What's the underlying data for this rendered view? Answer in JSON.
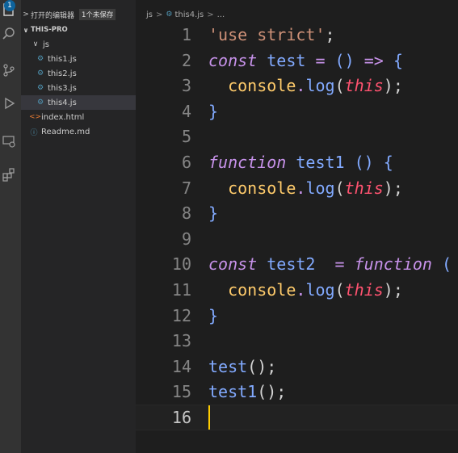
{
  "activity_bar": {
    "badge": "1",
    "icons": [
      "explorer-icon",
      "search-icon",
      "source-control-icon",
      "run-debug-icon",
      "remote-explorer-icon",
      "extensions-icon"
    ]
  },
  "sidebar": {
    "open_editors_label": "打开的编辑器",
    "unsaved_badge": "1个未保存",
    "project_name": "THIS-PRO",
    "folder": "js",
    "files": [
      "this1.js",
      "this2.js",
      "this3.js",
      "this4.js"
    ],
    "selected_file": "this4.js",
    "root_files": [
      "index.html",
      "Readme.md"
    ]
  },
  "breadcrumb": {
    "folder": "js",
    "file": "this4.js",
    "more": "..."
  },
  "editor": {
    "current_line": "16",
    "lines": [
      {
        "n": "1",
        "tokens": [
          {
            "t": "'use strict'",
            "c": "str"
          },
          {
            "t": ";",
            "c": "pl"
          }
        ]
      },
      {
        "n": "2",
        "tokens": [
          {
            "t": "const",
            "c": "kw"
          },
          {
            "t": " test ",
            "c": "fn"
          },
          {
            "t": "=",
            "c": "op"
          },
          {
            "t": " () ",
            "c": "fn"
          },
          {
            "t": "=>",
            "c": "op"
          },
          {
            "t": " {",
            "c": "fn"
          }
        ]
      },
      {
        "n": "3",
        "tokens": [
          {
            "t": "  ",
            "c": "pl"
          },
          {
            "t": "console",
            "c": "var"
          },
          {
            "t": ".",
            "c": "op"
          },
          {
            "t": "log",
            "c": "fn"
          },
          {
            "t": "(",
            "c": "pl"
          },
          {
            "t": "this",
            "c": "this"
          },
          {
            "t": ");",
            "c": "pl"
          }
        ]
      },
      {
        "n": "4",
        "tokens": [
          {
            "t": "}",
            "c": "fn"
          }
        ]
      },
      {
        "n": "5",
        "tokens": []
      },
      {
        "n": "6",
        "tokens": [
          {
            "t": "function",
            "c": "kw"
          },
          {
            "t": " test1 () {",
            "c": "fn"
          }
        ]
      },
      {
        "n": "7",
        "tokens": [
          {
            "t": "  ",
            "c": "pl"
          },
          {
            "t": "console",
            "c": "var"
          },
          {
            "t": ".",
            "c": "op"
          },
          {
            "t": "log",
            "c": "fn"
          },
          {
            "t": "(",
            "c": "pl"
          },
          {
            "t": "this",
            "c": "this"
          },
          {
            "t": ");",
            "c": "pl"
          }
        ]
      },
      {
        "n": "8",
        "tokens": [
          {
            "t": "}",
            "c": "fn"
          }
        ]
      },
      {
        "n": "9",
        "tokens": []
      },
      {
        "n": "10",
        "tokens": [
          {
            "t": "const",
            "c": "kw"
          },
          {
            "t": " test2  ",
            "c": "fn"
          },
          {
            "t": "=",
            "c": "op"
          },
          {
            "t": " ",
            "c": "pl"
          },
          {
            "t": "function",
            "c": "kw"
          },
          {
            "t": " (",
            "c": "fn"
          }
        ]
      },
      {
        "n": "11",
        "tokens": [
          {
            "t": "  ",
            "c": "pl"
          },
          {
            "t": "console",
            "c": "var"
          },
          {
            "t": ".",
            "c": "op"
          },
          {
            "t": "log",
            "c": "fn"
          },
          {
            "t": "(",
            "c": "pl"
          },
          {
            "t": "this",
            "c": "this"
          },
          {
            "t": ");",
            "c": "pl"
          }
        ]
      },
      {
        "n": "12",
        "tokens": [
          {
            "t": "}",
            "c": "fn"
          }
        ]
      },
      {
        "n": "13",
        "tokens": []
      },
      {
        "n": "14",
        "tokens": [
          {
            "t": "test",
            "c": "fn"
          },
          {
            "t": "();",
            "c": "pl"
          }
        ]
      },
      {
        "n": "15",
        "tokens": [
          {
            "t": "test1",
            "c": "fn"
          },
          {
            "t": "();",
            "c": "pl"
          }
        ]
      },
      {
        "n": "16",
        "tokens": []
      }
    ]
  },
  "colors": {
    "keyword": "#c792ea",
    "function": "#82aaff",
    "string": "#ce9178",
    "variable": "#ffcb6b",
    "this": "#ff5370",
    "cursor": "#ffcc00",
    "badge": "#0e639c"
  }
}
